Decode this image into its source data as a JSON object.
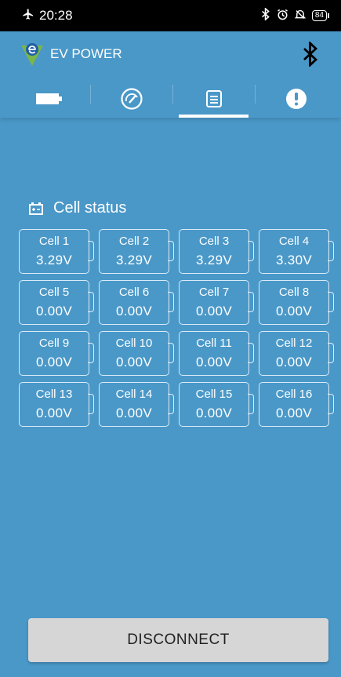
{
  "status_bar": {
    "time": "20:28",
    "battery_level": "84",
    "icons": [
      "airplane-icon",
      "bluetooth-icon",
      "alarm-icon",
      "dnd-icon",
      "battery-icon"
    ]
  },
  "header": {
    "app_name": "EV POWER",
    "logo_colors": {
      "green": "#7ab648",
      "blue": "#1e5fa8"
    }
  },
  "tabs": [
    {
      "icon": "battery-icon",
      "active": false
    },
    {
      "icon": "gauge-icon",
      "active": false
    },
    {
      "icon": "list-icon",
      "active": true
    },
    {
      "icon": "alert-icon",
      "active": false
    }
  ],
  "section": {
    "title": "Cell status"
  },
  "cells": [
    {
      "name": "Cell 1",
      "voltage": "3.29V"
    },
    {
      "name": "Cell 2",
      "voltage": "3.29V"
    },
    {
      "name": "Cell 3",
      "voltage": "3.29V"
    },
    {
      "name": "Cell 4",
      "voltage": "3.30V"
    },
    {
      "name": "Cell 5",
      "voltage": "0.00V"
    },
    {
      "name": "Cell 6",
      "voltage": "0.00V"
    },
    {
      "name": "Cell 7",
      "voltage": "0.00V"
    },
    {
      "name": "Cell 8",
      "voltage": "0.00V"
    },
    {
      "name": "Cell 9",
      "voltage": "0.00V"
    },
    {
      "name": "Cell 10",
      "voltage": "0.00V"
    },
    {
      "name": "Cell 11",
      "voltage": "0.00V"
    },
    {
      "name": "Cell 12",
      "voltage": "0.00V"
    },
    {
      "name": "Cell 13",
      "voltage": "0.00V"
    },
    {
      "name": "Cell 14",
      "voltage": "0.00V"
    },
    {
      "name": "Cell 15",
      "voltage": "0.00V"
    },
    {
      "name": "Cell 16",
      "voltage": "0.00V"
    }
  ],
  "footer": {
    "disconnect_label": "DISCONNECT"
  },
  "colors": {
    "background": "#4a98c8",
    "status_bar": "#000000",
    "button": "#d6d6d6"
  }
}
